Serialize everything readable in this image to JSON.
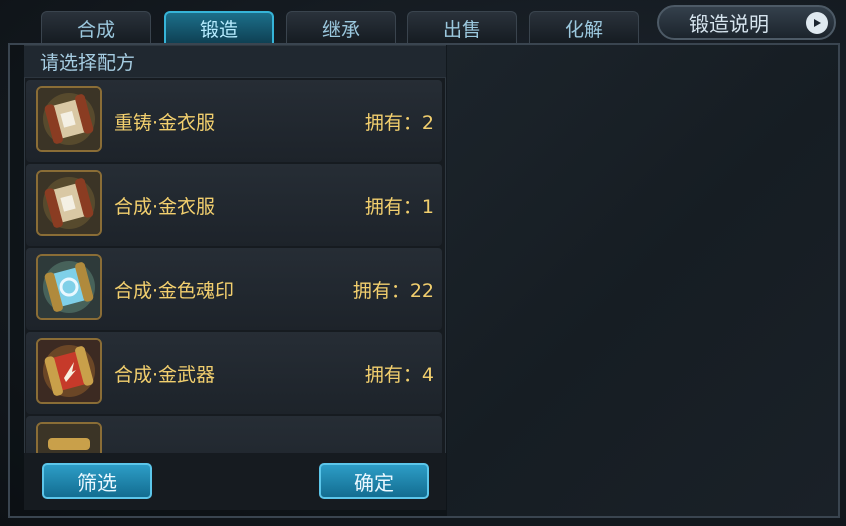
{
  "tabs": [
    {
      "label": "合成"
    },
    {
      "label": "锻造"
    },
    {
      "label": "继承"
    },
    {
      "label": "出售"
    },
    {
      "label": "化解"
    }
  ],
  "active_tab": "锻造",
  "help_button": {
    "label": "锻造说明",
    "icon": "play-icon"
  },
  "panel": {
    "title": "请选择配方"
  },
  "recipes": [
    {
      "name": "重铸·金衣服",
      "own": "拥有：2",
      "icon": "armor-scroll-icon"
    },
    {
      "name": "合成·金衣服",
      "own": "拥有：1",
      "icon": "armor-scroll-icon"
    },
    {
      "name": "合成·金色魂印",
      "own": "拥有：22",
      "icon": "soul-seal-scroll-icon"
    },
    {
      "name": "合成·金武器",
      "own": "拥有：4",
      "icon": "weapon-scroll-icon"
    }
  ],
  "buttons": {
    "filter": "筛选",
    "confirm": "确定"
  },
  "colors": {
    "accent": "#36b4d8",
    "gold_text": "#f2cf6e"
  }
}
